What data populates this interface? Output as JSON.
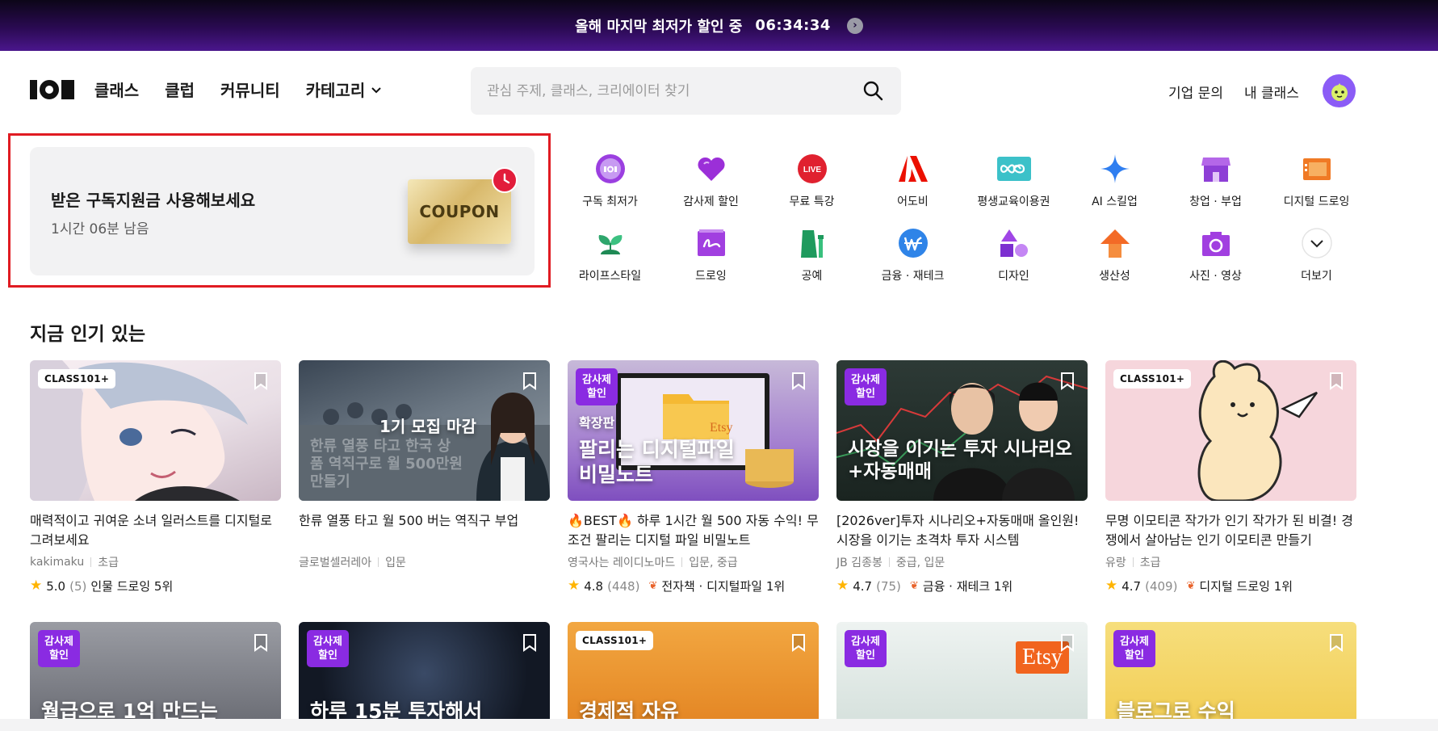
{
  "promo": {
    "text": "올해 마지막 최저가 할인 중",
    "timer": "06:34:34"
  },
  "header": {
    "nav": [
      "클래스",
      "클럽",
      "커뮤니티",
      "카테고리"
    ],
    "search_placeholder": "관심 주제, 클래스, 크리에이터 찾기",
    "links": [
      "기업 문의",
      "내 클래스"
    ]
  },
  "coupon": {
    "title": "받은 구독지원금 사용해보세요",
    "remaining": "1시간 06분 남음",
    "ticket_text": "COUPON"
  },
  "categories": [
    {
      "label": "구독 최저가",
      "icon": "class101-badge-icon"
    },
    {
      "label": "감사제 할인",
      "icon": "heart-icon"
    },
    {
      "label": "무료 특강",
      "icon": "live-icon"
    },
    {
      "label": "어도비",
      "icon": "adobe-icon"
    },
    {
      "label": "평생교육이용권",
      "icon": "infinity-icon"
    },
    {
      "label": "AI 스킬업",
      "icon": "sparkle-icon"
    },
    {
      "label": "창업 · 부업",
      "icon": "store-icon"
    },
    {
      "label": "디지털 드로잉",
      "icon": "tablet-icon"
    },
    {
      "label": "라이프스타일",
      "icon": "sprout-icon"
    },
    {
      "label": "드로잉",
      "icon": "drawing-icon"
    },
    {
      "label": "공예",
      "icon": "craft-icon"
    },
    {
      "label": "금융 · 재테크",
      "icon": "won-coin-icon"
    },
    {
      "label": "디자인",
      "icon": "shapes-icon"
    },
    {
      "label": "생산성",
      "icon": "arrow-up-icon"
    },
    {
      "label": "사진 · 영상",
      "icon": "camera-icon"
    },
    {
      "label": "더보기",
      "icon": "chevron-down-icon"
    }
  ],
  "popular": {
    "title": "지금 인기 있는",
    "cards": [
      {
        "badge": "CLASS101+",
        "thumb_text": "",
        "title": "매력적이고 귀여운 소녀 일러스트를 디지털로 그려보세요",
        "author": "kakimaku",
        "level": "초급",
        "rating": "5.0",
        "count": "(5)",
        "rank": "인물 드로잉 5위",
        "bg": "#f3e9ee"
      },
      {
        "badge": "",
        "thumb_text": "1기 모집 마감",
        "thumb_sub": "한류 열풍 타고 한국 상품 역직구로 월 500만원 만들기",
        "title": "한류 열풍 타고 월 500 버는 역직구 부업",
        "author": "글로벌셀러레아",
        "level": "입문",
        "rating": "",
        "count": "",
        "rank": "",
        "bg": "#55606a"
      },
      {
        "badge": "감사제 할인",
        "thumb_text": "팔리는 디지털파일 비밀노트",
        "thumb_sub": "확장판",
        "title": "🔥BEST🔥 하루 1시간 월 500 자동 수익! 무조건 팔리는 디지털 파일 비밀노트",
        "author": "영국사는 레이디노마드",
        "level": "입문, 중급",
        "rating": "4.8",
        "count": "(448)",
        "rank": "전자책 · 디지털파일 1위",
        "bg": "#9a6fc8"
      },
      {
        "badge": "감사제 할인",
        "thumb_text": "시장을 이기는 투자 시나리오+자동매매",
        "title": "[2026ver]투자 시나리오+자동매매 올인원! 시장을 이기는 초격차 투자 시스템",
        "author": "JB 김종봉",
        "level": "중급, 입문",
        "rating": "4.7",
        "count": "(75)",
        "rank": "금융 · 재테크 1위",
        "bg": "#1b2a26"
      },
      {
        "badge": "CLASS101+",
        "thumb_text": "",
        "title": "무명 이모티콘 작가가 인기 작가가 된 비결! 경쟁에서 살아남는 인기 이모티콘 만들기",
        "author": "유랑",
        "level": "초급",
        "rating": "4.7",
        "count": "(409)",
        "rank": "디지털 드로잉 1위",
        "bg": "#f7d9de"
      }
    ]
  },
  "second_row": [
    {
      "badge": "감사제 할인",
      "thumb_text": "월급으로 1억 만드는",
      "bg": "#7d7f86"
    },
    {
      "badge": "감사제 할인",
      "thumb_text": "하루 15분 투자해서",
      "bg": "#1c2436"
    },
    {
      "badge": "CLASS101+",
      "thumb_text": "경제적 자유",
      "bg": "#e8922a"
    },
    {
      "badge": "감사제 할인",
      "thumb_text": "Etsy",
      "bg": "#dfe9e6"
    },
    {
      "badge": "감사제 할인",
      "thumb_text": "블로그로 수익",
      "bg": "#f3cf5c"
    }
  ],
  "colors": {
    "accent_purple": "#8a2be2",
    "promo_bg": "#2a0a52",
    "outline_red": "#e01b22",
    "star": "#ffb400"
  }
}
